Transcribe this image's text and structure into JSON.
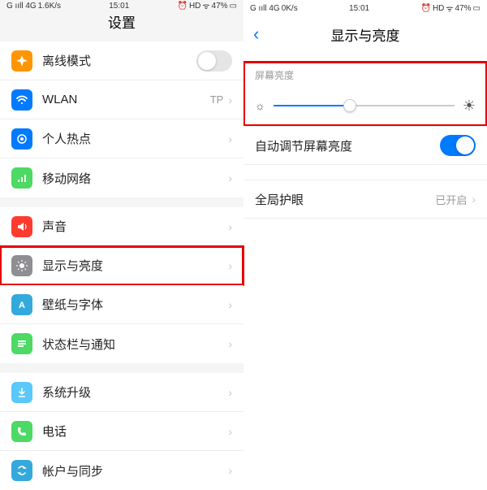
{
  "left": {
    "status": {
      "carrier": "G ııll 4G",
      "speed": "1.6K/s",
      "time": "15:01",
      "alarm": "⏰",
      "hd": "HD",
      "wifi": "ᯤ",
      "battery": "47%",
      "batt_icon": "▭"
    },
    "title": "设置",
    "rows": {
      "airplane": {
        "label": "离线模式"
      },
      "wlan": {
        "label": "WLAN",
        "detail": "TP"
      },
      "hotspot": {
        "label": "个人热点"
      },
      "mobile": {
        "label": "移动网络"
      },
      "sound": {
        "label": "声音"
      },
      "display": {
        "label": "显示与亮度"
      },
      "wallpaper": {
        "label": "壁纸与字体"
      },
      "statusbar": {
        "label": "状态栏与通知"
      },
      "update": {
        "label": "系统升级"
      },
      "phone": {
        "label": "电话"
      },
      "account": {
        "label": "帐户与同步"
      }
    }
  },
  "right": {
    "status": {
      "carrier": "G ııll 4G",
      "speed": "0K/s",
      "time": "15:01",
      "alarm": "⏰",
      "hd": "HD",
      "wifi": "ᯤ",
      "battery": "47%",
      "batt_icon": "▭"
    },
    "title": "显示与亮度",
    "section_label": "屏幕亮度",
    "auto_brightness": "自动调节屏幕亮度",
    "eye_protect": {
      "label": "全局护眼",
      "detail": "已开启"
    },
    "slider": {
      "value": 42
    }
  },
  "icons": {
    "sun_small": "☼",
    "sun_big": "☀"
  }
}
